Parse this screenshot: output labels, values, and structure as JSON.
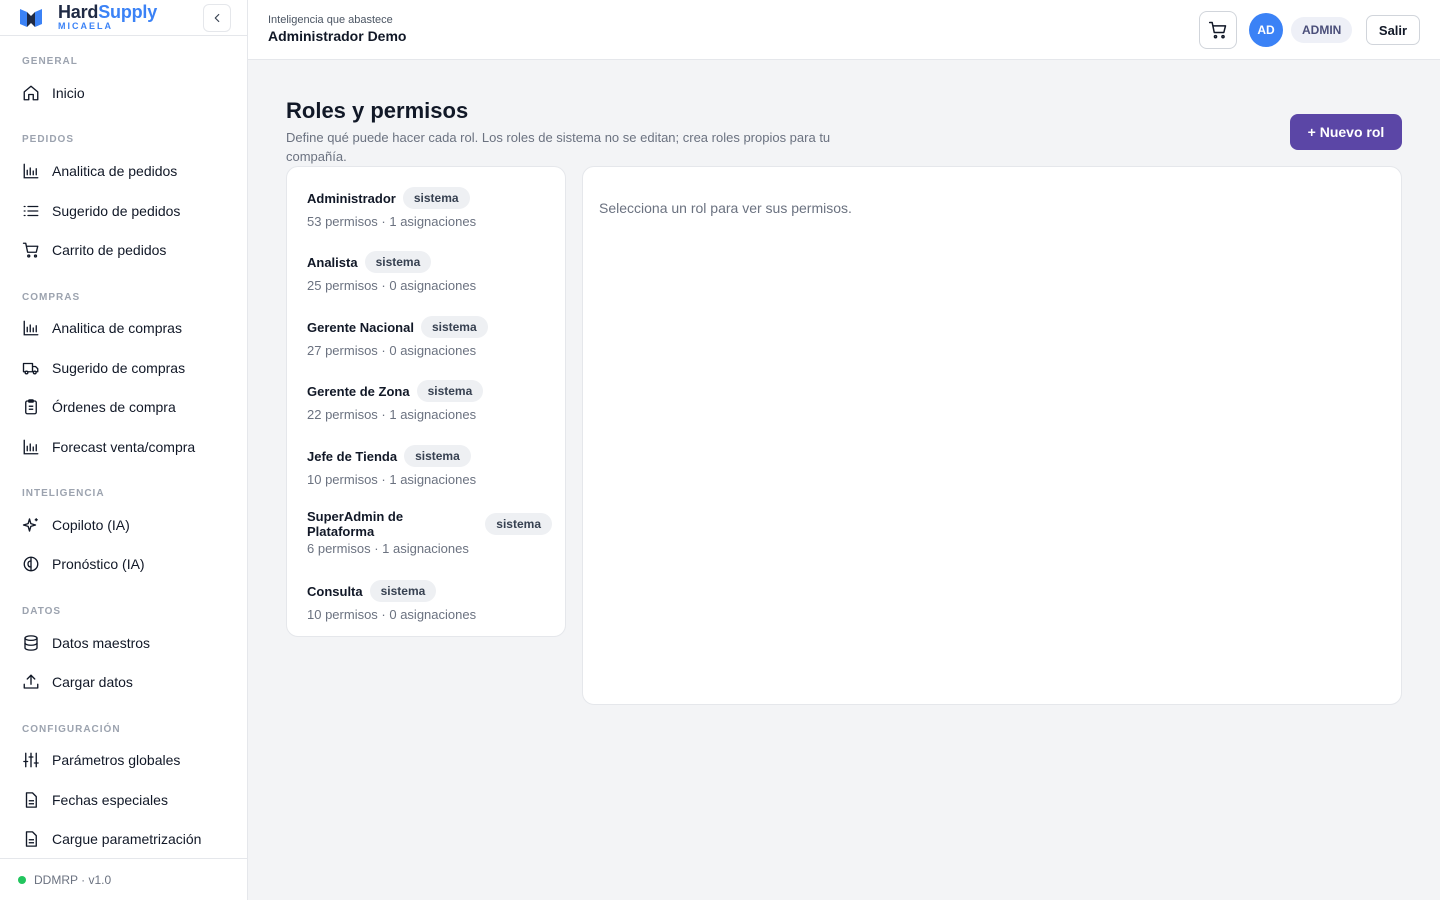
{
  "brand": {
    "name_part1": "Hard",
    "name_part2": "Supply",
    "subtitle": "MICAELA"
  },
  "sidebar": {
    "sections": [
      {
        "label": "GENERAL"
      },
      {
        "label": "PEDIDOS"
      },
      {
        "label": "COMPRAS"
      },
      {
        "label": "INTELIGENCIA"
      },
      {
        "label": "DATOS"
      },
      {
        "label": "CONFIGURACIÓN"
      }
    ],
    "items": [
      {
        "label": "Inicio",
        "icon": "home-icon"
      },
      {
        "label": "Analitica de pedidos",
        "icon": "bar-chart-icon"
      },
      {
        "label": "Sugerido de pedidos",
        "icon": "list-icon"
      },
      {
        "label": "Carrito de pedidos",
        "icon": "cart-icon"
      },
      {
        "label": "Analitica de compras",
        "icon": "bar-chart-icon"
      },
      {
        "label": "Sugerido de compras",
        "icon": "truck-icon"
      },
      {
        "label": "Órdenes de compra",
        "icon": "clipboard-icon"
      },
      {
        "label": "Forecast venta/compra",
        "icon": "bar-chart-icon"
      },
      {
        "label": "Copiloto (IA)",
        "icon": "sparkles-icon"
      },
      {
        "label": "Pronóstico (IA)",
        "icon": "brain-icon"
      },
      {
        "label": "Datos maestros",
        "icon": "database-icon"
      },
      {
        "label": "Cargar datos",
        "icon": "upload-icon"
      },
      {
        "label": "Parámetros globales",
        "icon": "sliders-icon"
      },
      {
        "label": "Fechas especiales",
        "icon": "file-icon"
      },
      {
        "label": "Cargue parametrización",
        "icon": "file-icon"
      }
    ],
    "footer": "DDMRP · v1.0"
  },
  "header": {
    "subtitle": "Inteligencia que abastece",
    "title": "Administrador Demo",
    "avatar_initials": "AD",
    "role": "ADMIN",
    "logout_label": "Salir"
  },
  "main": {
    "title": "Roles y permisos",
    "description": "Define qué puede hacer cada rol. Los roles de sistema no se editan; crea roles propios para tu compañía.",
    "new_role_label": "+ Nuevo rol",
    "roles": [
      {
        "name": "Administrador",
        "tag": "sistema",
        "meta": "53 permisos · 1 asignaciones"
      },
      {
        "name": "Analista",
        "tag": "sistema",
        "meta": "25 permisos · 0 asignaciones"
      },
      {
        "name": "Gerente Nacional",
        "tag": "sistema",
        "meta": "27 permisos · 0 asignaciones"
      },
      {
        "name": "Gerente de Zona",
        "tag": "sistema",
        "meta": "22 permisos · 1 asignaciones"
      },
      {
        "name": "Jefe de Tienda",
        "tag": "sistema",
        "meta": "10 permisos · 1 asignaciones"
      },
      {
        "name": "SuperAdmin de Plataforma",
        "tag": "sistema",
        "meta": "6 permisos · 1 asignaciones"
      },
      {
        "name": "Consulta",
        "tag": "sistema",
        "meta": "10 permisos · 0 asignaciones"
      }
    ],
    "empty_detail": "Selecciona un rol para ver sus permisos."
  },
  "colors": {
    "accent": "#5b46a6",
    "brand_blue": "#3b82f6",
    "status_green": "#22c55e"
  }
}
